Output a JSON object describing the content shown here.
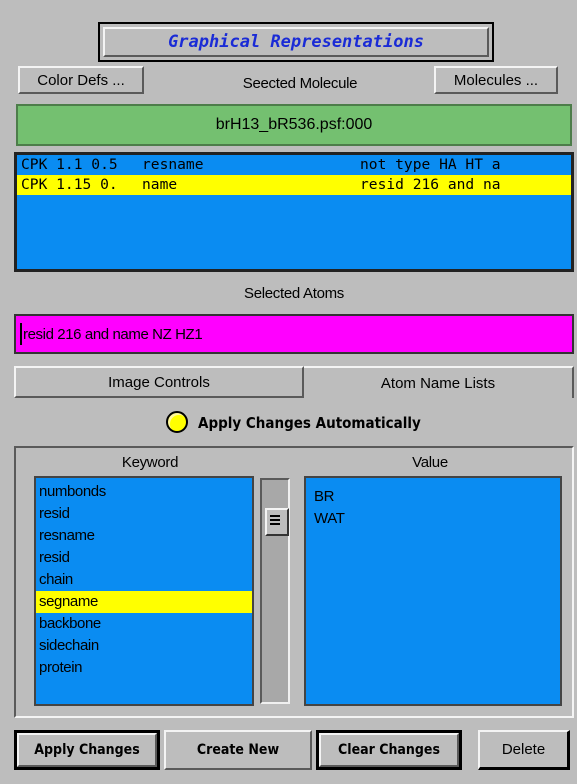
{
  "title": "Graphical Representations",
  "header": {
    "color_defs_label": "Color Defs ...",
    "selected_molecule_label": "Seected Molecule",
    "molecules_label": "Molecules ..."
  },
  "molecule": {
    "name": "brH13_bR536.psf:000",
    "color": "#74c070"
  },
  "representations": [
    {
      "style": "CPK 1.1 0.5",
      "color": "resname",
      "selection": "not type HA HT a",
      "selected": false
    },
    {
      "style": "CPK 1.15 0.",
      "color": "name",
      "selection": "resid 216 and na",
      "selected": true
    }
  ],
  "selected_atoms": {
    "label": "Selected Atoms",
    "value": "resid 216 and name NZ HZ1"
  },
  "tabs": {
    "image_controls": "Image Controls",
    "atom_name_lists": "Atom Name Lists"
  },
  "apply_auto": {
    "label": "Apply Changes Automatically",
    "on": true
  },
  "keyword_panel": {
    "keyword_header": "Keyword",
    "value_header": "Value",
    "keywords": [
      "numbonds",
      "resid",
      "resname",
      "resid",
      "chain",
      "segname",
      "backbone",
      "sidechain",
      "protein"
    ],
    "selected_keyword_index": 5,
    "values": [
      "BR",
      "WAT"
    ]
  },
  "buttons": {
    "apply_changes": "Apply Changes",
    "create_new": "Create New",
    "clear_changes": "Clear Changes",
    "delete": "Delete"
  },
  "colors": {
    "list_bg": "#0a8cf2",
    "selection": "#ffff00",
    "atoms_field": "#ff00ff",
    "title_text": "#1a2bd6"
  }
}
